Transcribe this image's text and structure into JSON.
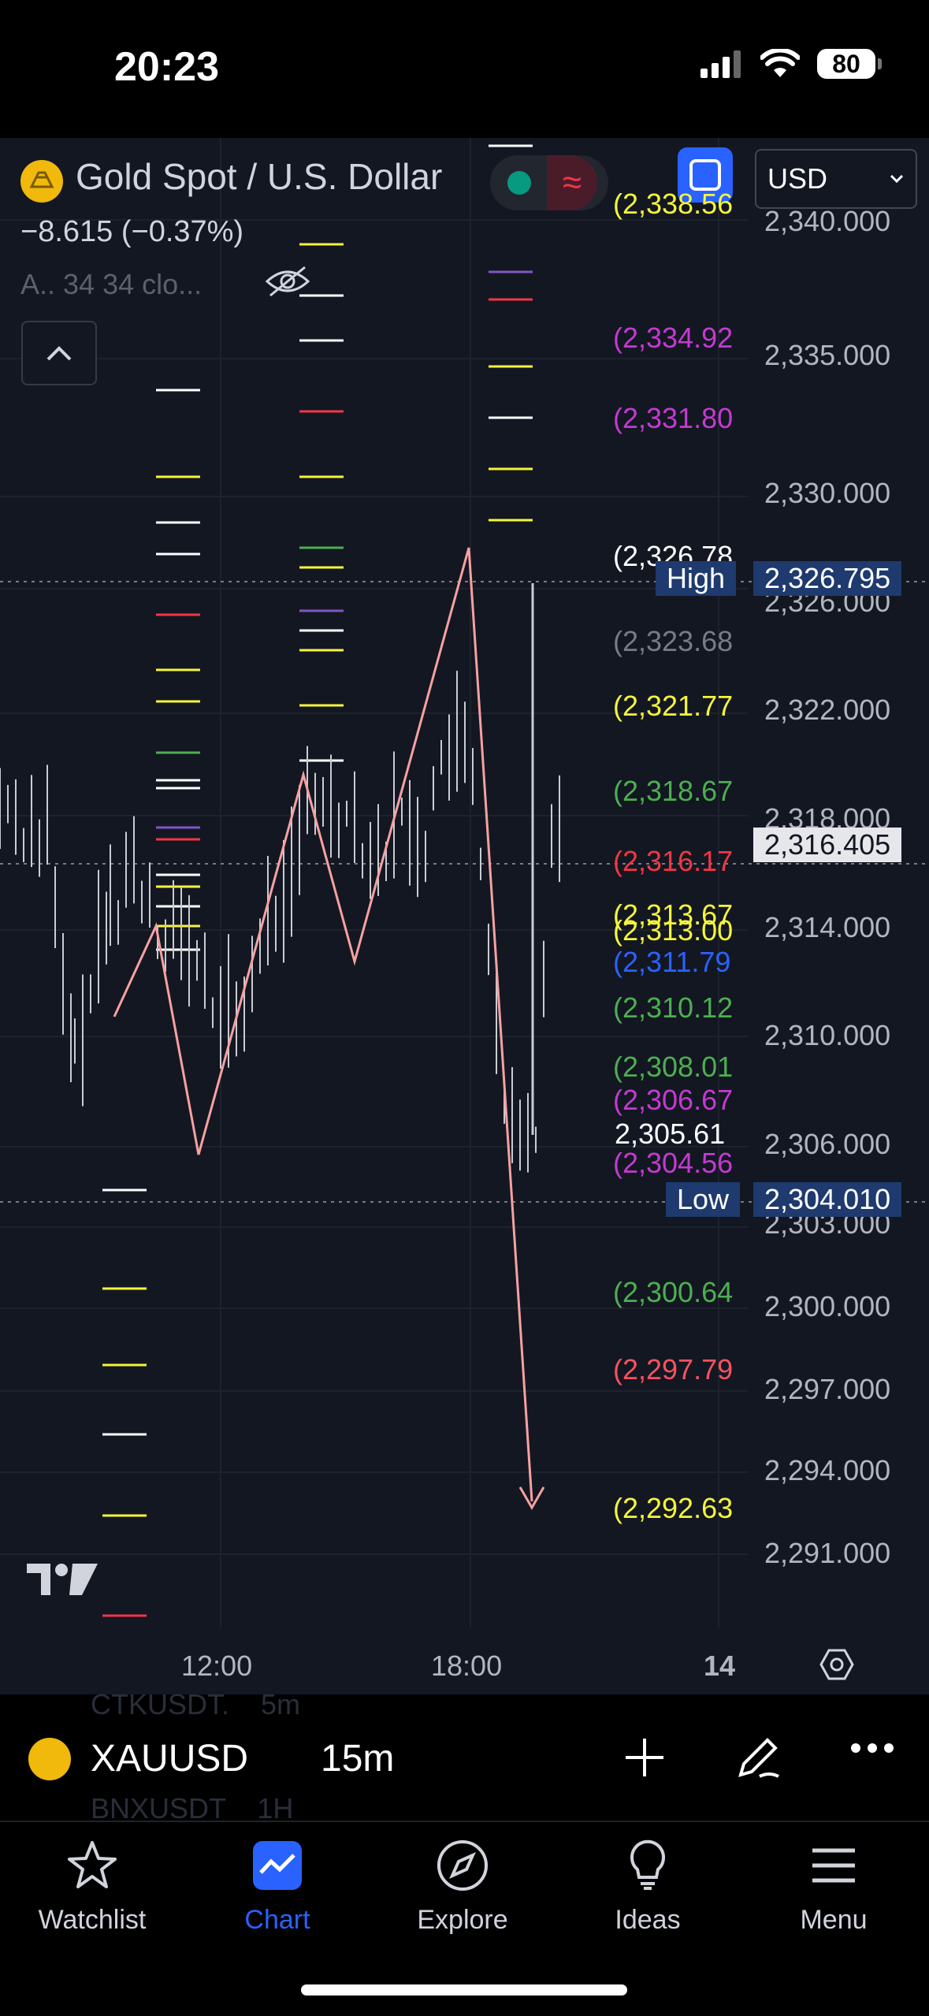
{
  "status_bar": {
    "time": "20:23",
    "battery": "80"
  },
  "header": {
    "symbol_title": "Gold Spot / U.S. Dollar",
    "price_change": "−8.615 (−0.37%)",
    "indicator_text": "A.. 34 34 clo...",
    "currency": "USD"
  },
  "price_axis": {
    "ticks": [
      "2,340.000",
      "2,335.000",
      "2,330.000",
      "2,326.000",
      "2,322.000",
      "2,318.000",
      "2,314.000",
      "2,310.000",
      "2,306.000",
      "2,303.000",
      "2,300.000",
      "2,297.000",
      "2,294.000",
      "2,291.000"
    ],
    "high_label": "High",
    "high_value": "2,326.795",
    "current_price": "2,316.405",
    "low_label": "Low",
    "low_value": "2,304.010"
  },
  "level_labels": [
    {
      "text": "(2,338.56",
      "color": "#f5f53a"
    },
    {
      "text": "(2,334.92",
      "color": "#c43ad1"
    },
    {
      "text": "(2,331.80",
      "color": "#c43ad1"
    },
    {
      "text": "(2,326.78",
      "color": "#ffffff"
    },
    {
      "text": "(2,323.68",
      "color": "#787b86"
    },
    {
      "text": "(2,321.77",
      "color": "#f5f53a"
    },
    {
      "text": "(2,318.67",
      "color": "#4caf50"
    },
    {
      "text": "(2,316.17",
      "color": "#f23645"
    },
    {
      "text": "(2,313.67",
      "color": "#f5f53a"
    },
    {
      "text": "(2,313.00",
      "color": "#f5f53a"
    },
    {
      "text": "(2,311.79",
      "color": "#2962ff"
    },
    {
      "text": "(2,310.12",
      "color": "#4caf50"
    },
    {
      "text": "(2,308.01",
      "color": "#4caf50"
    },
    {
      "text": "(2,306.67",
      "color": "#c43ad1"
    },
    {
      "text": "2,305.61",
      "color": "#ffffff"
    },
    {
      "text": "(2,304.56",
      "color": "#c43ad1"
    },
    {
      "text": "(2,300.64",
      "color": "#4caf50"
    },
    {
      "text": "(2,297.79",
      "color": "#f7525f"
    },
    {
      "text": "(2,292.63",
      "color": "#f5f53a"
    }
  ],
  "time_axis": [
    "12:00",
    "18:00",
    "14"
  ],
  "symbol_bar": {
    "symbol": "XAUUSD",
    "interval": "15m",
    "ghost_top": "CTKUSDT.    5m",
    "ghost_bottom": "BNXUSDT    1H"
  },
  "bottom_nav": [
    {
      "label": "Watchlist",
      "icon": "star-icon"
    },
    {
      "label": "Chart",
      "icon": "chart-icon"
    },
    {
      "label": "Explore",
      "icon": "compass-icon"
    },
    {
      "label": "Ideas",
      "icon": "lightbulb-icon"
    },
    {
      "label": "Menu",
      "icon": "hamburger-icon"
    }
  ],
  "colors": {
    "accent": "#2962ff",
    "chart_bg": "#131722",
    "zigzag": "#f7a1a1"
  }
}
